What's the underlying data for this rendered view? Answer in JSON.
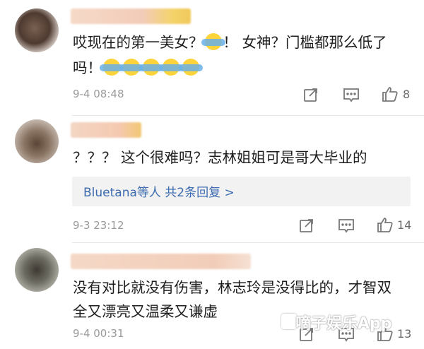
{
  "comments": [
    {
      "text_line1": "哎现在的第一美女？",
      "text_line1_after": "！ 女神？门槛都那么低了",
      "text_line2": "吗！",
      "emoji_name": "shrug-emoji",
      "emoji_count_line1": 1,
      "emoji_count_line2": 5,
      "time": "9-4 08:48",
      "likes": "8"
    },
    {
      "text_line1": "？？？ 这个很难吗？志林姐姐可是哥大毕业的",
      "reply_summary": "Bluetana等人  共2条回复 >",
      "time": "9-3 23:12",
      "likes": "14"
    },
    {
      "text_line1": "没有对比就没有伤害，林志玲是没得比的，才智双",
      "text_line2": "全又漂亮又温柔又谦虚",
      "time": "9-4 00:31",
      "likes": "13"
    }
  ],
  "watermark": "嘀子娱乐App",
  "icons": [
    "share-icon",
    "comment-icon",
    "like-icon"
  ]
}
